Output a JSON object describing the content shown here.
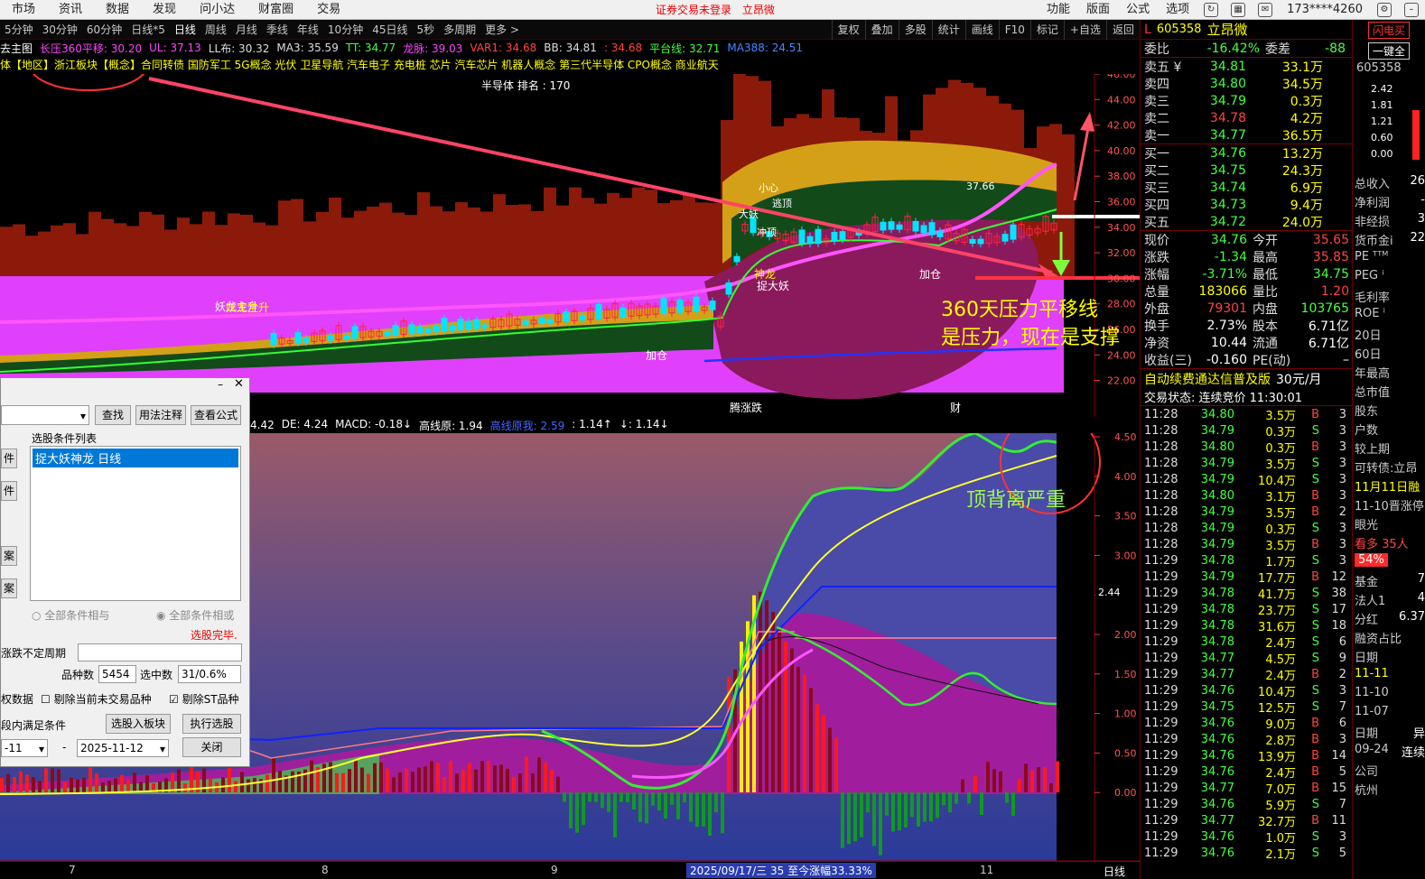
{
  "menu": {
    "items": [
      "市场",
      "资讯",
      "数据",
      "发现",
      "问小达",
      "财富圈",
      "交易"
    ],
    "status_warning": "证券交易未登录",
    "status_link": "立昂微",
    "right_items": [
      "功能",
      "版面",
      "公式",
      "选项"
    ],
    "account": "173****4260"
  },
  "periods": {
    "items": [
      "5分钟",
      "30分钟",
      "60分钟",
      "日线*5",
      "日线",
      "周线",
      "月线",
      "季线",
      "年线",
      "10分钟",
      "45日线",
      "5秒",
      "多周期",
      "更多 >"
    ],
    "active": "日线",
    "tools": [
      "复权",
      "叠加",
      "多股",
      "统计",
      "画线",
      "F10",
      "标记",
      "+自选",
      "返回"
    ]
  },
  "indicators": [
    {
      "label": "去主图",
      "color": "#ffffff"
    },
    {
      "label": "长压360平移: 30.20",
      "color": "#ff44ff"
    },
    {
      "label": "UL: 37.13",
      "color": "#ff44ff"
    },
    {
      "label": "LL布: 30.32",
      "color": "#dddddd"
    },
    {
      "label": "MA3: 35.59",
      "color": "#dddddd"
    },
    {
      "label": "TT: 34.77",
      "color": "#44ff44"
    },
    {
      "label": "龙脉: 39.03",
      "color": "#ff44ff"
    },
    {
      "label": "VAR1: 34.68",
      "color": "#ff4444"
    },
    {
      "label": "BB: 34.81",
      "color": "#dddddd"
    },
    {
      "label": ": 34.68",
      "color": "#ff4444"
    },
    {
      "label": "平台线: 32.71",
      "color": "#44ff44"
    },
    {
      "label": "MA388: 24.51",
      "color": "#4488ff"
    }
  ],
  "concepts": "体【地区】浙江板块【概念】合同转债 国防军工 5G概念 光伏 卫星导航 汽车电子 充电桩 芯片 汽车芯片 机器人概念 第三代半导体 CPO概念 商业航天",
  "rank_line": "半导体  排名 : 170",
  "main_chart": {
    "y_ticks": [
      "46.00",
      "44.00",
      "42.00",
      "40.00",
      "38.00",
      "36.00",
      "34.00",
      "32.00",
      "30.00",
      "28.00",
      "26.00",
      "24.00",
      "22.00"
    ],
    "labels": {
      "yaolong": "妖龙主升",
      "jiacang1": "加仓",
      "jiacang2": "加仓",
      "zhuodayao": "捉大妖",
      "shenlong": "神龙",
      "xiaoxin": "小心",
      "taoxian": "逃顶",
      "dayaoshi": "大妖",
      "chuanyue": "冲顶",
      "price_tag": "37.66",
      "yaozhangdie": "腾涨跌",
      "cai": "财"
    },
    "annotation1": "360天压力平移线",
    "annotation2": "是压力，现在是支撑"
  },
  "sub_chart": {
    "label_left": "4.42",
    "indicators": [
      {
        "label": "DE: 4.24",
        "color": "#ffffff"
      },
      {
        "label": "MACD: -0.18↓",
        "color": "#ffffff"
      },
      {
        "label": "高线原: 1.94",
        "color": "#ffffff"
      },
      {
        "label": "高线原我: 2.59",
        "color": "#4466ff"
      },
      {
        "label": ": 1.14↑",
        "color": "#ffffff"
      },
      {
        "label": "↓: 1.14↓",
        "color": "#ffffff"
      }
    ],
    "y_ticks": [
      "4.50",
      "4.00",
      "3.50",
      "3.00",
      "2.50",
      "2.00",
      "1.50",
      "1.00",
      "0.50",
      "0.00"
    ],
    "current_value": "2.44",
    "annotation": "顶背离严重"
  },
  "x_axis": {
    "labels": [
      "7",
      "8",
      "9",
      "11"
    ],
    "cursor": "2025/09/17/三  35 至今涨幅33.33%",
    "period_label": "日线"
  },
  "dialog": {
    "search_btn": "查找",
    "usage_btn": "用法注释",
    "formula_btn": "查看公式",
    "list_title": "选股条件列表",
    "list_item": "捉大妖神龙  日线",
    "left_btns": [
      "件",
      "件",
      "案",
      "案"
    ],
    "radio1": "全部条件相与",
    "radio2": "全部条件相或",
    "status": "选股完毕.",
    "period_label": "涨跌不定周期",
    "count_label": "品种数",
    "count_value": "5454",
    "selected_label": "选中数",
    "selected_value": "31/0.6%",
    "chk1": "权数据",
    "chk2": "剔除当前未交易品种",
    "chk3": "剔除ST品种",
    "range_label": "段内满足条件",
    "to_board_btn": "选股入板块",
    "exec_btn": "执行选股",
    "date_from": "-11",
    "date_sep": "-",
    "date_to": "2025-11-12",
    "close_btn": "关闭"
  },
  "quote": {
    "prefix": "L",
    "code": "605358",
    "name": "立昂微",
    "weibi_label": "委比",
    "weibi": "-16.42%",
    "weicha_label": "委差",
    "weicha": "-88",
    "asks": [
      {
        "label": "卖五 ¥",
        "price": "34.81",
        "vol": "33.1万"
      },
      {
        "label": "卖四",
        "price": "34.80",
        "vol": "34.5万"
      },
      {
        "label": "卖三",
        "price": "34.79",
        "vol": "0.3万"
      },
      {
        "label": "卖二",
        "price": "34.78",
        "vol": "4.2万"
      },
      {
        "label": "卖一",
        "price": "34.77",
        "vol": "36.5万"
      }
    ],
    "bids": [
      {
        "label": "买一",
        "price": "34.76",
        "vol": "13.2万"
      },
      {
        "label": "买二",
        "price": "34.75",
        "vol": "24.3万"
      },
      {
        "label": "买三",
        "price": "34.74",
        "vol": "6.9万"
      },
      {
        "label": "买四",
        "price": "34.73",
        "vol": "9.4万"
      },
      {
        "label": "买五",
        "price": "34.72",
        "vol": "24.0万"
      }
    ],
    "stats": [
      {
        "k1": "现价",
        "v1": "34.76",
        "c1": "#44ff44",
        "k2": "今开",
        "v2": "35.65",
        "c2": "#ff4444"
      },
      {
        "k1": "涨跌",
        "v1": "-1.34",
        "c1": "#44ff44",
        "k2": "最高",
        "v2": "35.85",
        "c2": "#ff4444"
      },
      {
        "k1": "涨幅",
        "v1": "-3.71%",
        "c1": "#44ff44",
        "k2": "最低",
        "v2": "34.75",
        "c2": "#44ff44"
      },
      {
        "k1": "总量",
        "v1": "183066",
        "c1": "#ffff00",
        "k2": "量比",
        "v2": "1.20",
        "c2": "#ff4444"
      },
      {
        "k1": "外盘",
        "v1": "79301",
        "c1": "#ff4444",
        "k2": "内盘",
        "v2": "103765",
        "c2": "#44ff44"
      },
      {
        "k1": "换手",
        "v1": "2.73%",
        "c1": "#ffffff",
        "k2": "股本",
        "v2": "6.71亿",
        "c2": "#ffffff"
      },
      {
        "k1": "净资",
        "v1": "10.44",
        "c1": "#ffffff",
        "k2": "流通",
        "v2": "6.71亿",
        "c2": "#ffffff"
      },
      {
        "k1": "收益(三)",
        "v1": "-0.160",
        "c1": "#ffffff",
        "k2": "PE(动)",
        "v2": "–",
        "c2": "#ffffff"
      }
    ],
    "promo": "自动续费通达信普及版",
    "promo_price": "30元/月",
    "trade_status": "交易状态: 连续竞价 11:30:01",
    "ticks": [
      {
        "t": "11:28",
        "p": "34.80",
        "v": "3.5万",
        "s": "B",
        "n": "3"
      },
      {
        "t": "11:28",
        "p": "34.79",
        "v": "0.3万",
        "s": "S",
        "n": "3"
      },
      {
        "t": "11:28",
        "p": "34.80",
        "v": "0.3万",
        "s": "B",
        "n": "3"
      },
      {
        "t": "11:28",
        "p": "34.79",
        "v": "3.5万",
        "s": "S",
        "n": "3"
      },
      {
        "t": "11:28",
        "p": "34.79",
        "v": "10.4万",
        "s": "S",
        "n": "3"
      },
      {
        "t": "11:28",
        "p": "34.80",
        "v": "3.1万",
        "s": "B",
        "n": "3"
      },
      {
        "t": "11:28",
        "p": "34.79",
        "v": "3.5万",
        "s": "B",
        "n": "2"
      },
      {
        "t": "11:28",
        "p": "34.79",
        "v": "0.3万",
        "s": "S",
        "n": "3"
      },
      {
        "t": "11:28",
        "p": "34.79",
        "v": "3.5万",
        "s": "B",
        "n": "3"
      },
      {
        "t": "11:29",
        "p": "34.78",
        "v": "1.7万",
        "s": "S",
        "n": "3"
      },
      {
        "t": "11:29",
        "p": "34.79",
        "v": "17.7万",
        "s": "B",
        "n": "12"
      },
      {
        "t": "11:29",
        "p": "34.78",
        "v": "41.7万",
        "s": "S",
        "n": "38"
      },
      {
        "t": "11:29",
        "p": "34.78",
        "v": "23.7万",
        "s": "S",
        "n": "17"
      },
      {
        "t": "11:29",
        "p": "34.78",
        "v": "31.6万",
        "s": "S",
        "n": "18"
      },
      {
        "t": "11:29",
        "p": "34.78",
        "v": "2.4万",
        "s": "S",
        "n": "6"
      },
      {
        "t": "11:29",
        "p": "34.77",
        "v": "4.5万",
        "s": "S",
        "n": "9"
      },
      {
        "t": "11:29",
        "p": "34.77",
        "v": "2.4万",
        "s": "B",
        "n": "2"
      },
      {
        "t": "11:29",
        "p": "34.76",
        "v": "10.4万",
        "s": "S",
        "n": "3"
      },
      {
        "t": "11:29",
        "p": "34.75",
        "v": "12.5万",
        "s": "S",
        "n": "7"
      },
      {
        "t": "11:29",
        "p": "34.76",
        "v": "9.0万",
        "s": "B",
        "n": "6"
      },
      {
        "t": "11:29",
        "p": "34.76",
        "v": "2.8万",
        "s": "B",
        "n": "3"
      },
      {
        "t": "11:29",
        "p": "34.76",
        "v": "13.9万",
        "s": "B",
        "n": "14"
      },
      {
        "t": "11:29",
        "p": "34.76",
        "v": "2.4万",
        "s": "B",
        "n": "5"
      },
      {
        "t": "11:29",
        "p": "34.77",
        "v": "7.0万",
        "s": "B",
        "n": "15"
      },
      {
        "t": "11:29",
        "p": "34.76",
        "v": "5.9万",
        "s": "S",
        "n": "7"
      },
      {
        "t": "11:29",
        "p": "34.77",
        "v": "32.7万",
        "s": "B",
        "n": "11"
      },
      {
        "t": "11:29",
        "p": "34.76",
        "v": "1.0万",
        "s": "S",
        "n": "3"
      },
      {
        "t": "11:29",
        "p": "34.76",
        "v": "2.1万",
        "s": "S",
        "n": "5"
      }
    ]
  },
  "side": {
    "top_btn1": "闪电买",
    "top_btn2": "一键全",
    "code": "605358",
    "mini_ticks": [
      "2.42",
      "1.81",
      "1.21",
      "0.60",
      "0.00"
    ],
    "items": [
      "总收入",
      "净利润",
      "非经损",
      "货币金i",
      "PE ᵀᵀᴹ",
      "PEG ⁱ",
      "毛利率",
      "ROE ⁱ",
      "20日",
      "60日",
      "年最高",
      "总市值",
      "股东",
      "户数",
      "较上期",
      "可转债:立昂",
      "11月11日融",
      "11-10晋涨停",
      "眼光",
      "看多 35人",
      "54%",
      "基金",
      "法人1",
      "分红",
      "融资占比",
      "日期",
      "11-11",
      "11-10",
      "11-07",
      "日期",
      "09-24",
      "公司",
      "杭州"
    ],
    "right_vals": [
      "26",
      "-",
      "3",
      "22",
      "",
      "",
      "",
      "",
      "",
      "",
      "",
      "",
      "",
      "",
      "",
      "",
      "",
      "",
      "",
      "",
      "",
      "7",
      "4",
      "6.37",
      "",
      "",
      "",
      "",
      "",
      "异",
      "连续",
      "",
      ""
    ]
  }
}
